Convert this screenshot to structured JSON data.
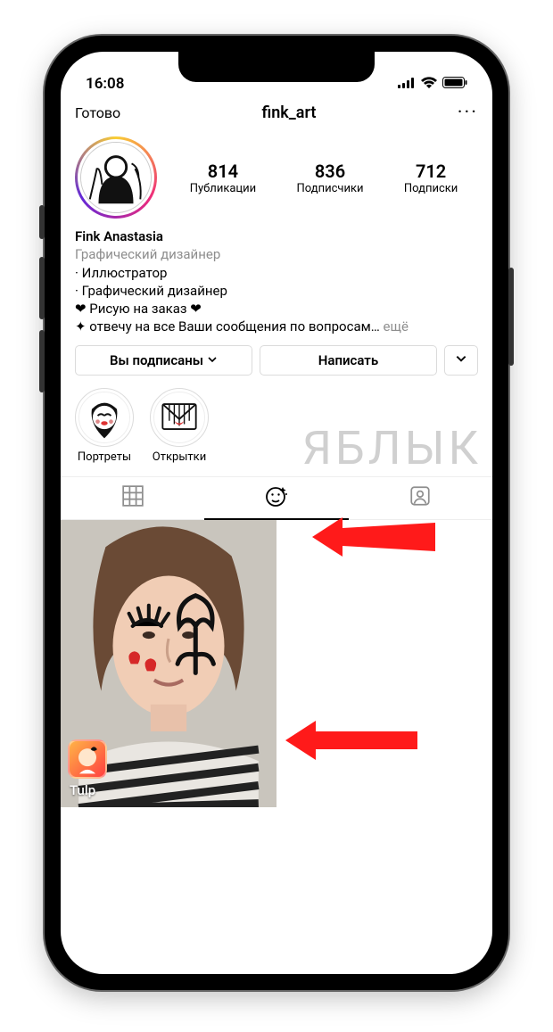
{
  "status": {
    "time": "16:08"
  },
  "nav": {
    "done": "Готово",
    "username": "fink_art",
    "more": "···"
  },
  "stats": {
    "posts": {
      "value": "814",
      "label": "Публикации"
    },
    "followers": {
      "value": "836",
      "label": "Подписчики"
    },
    "following": {
      "value": "712",
      "label": "Подписки"
    }
  },
  "bio": {
    "name": "Fink Anastasia",
    "job": "Графический дизайнер",
    "line1": "· Иллюстратор",
    "line2": "· Графический дизайнер",
    "line3": "❤ Рисую на заказ ❤",
    "line4": "✦ отвечу на все Ваши сообщения по вопросам…",
    "more": "ещё"
  },
  "buttons": {
    "following": "Вы подписаны",
    "message": "Написать"
  },
  "highlights": [
    {
      "label": "Портреты"
    },
    {
      "label": "Открытки"
    }
  ],
  "filters": [
    {
      "label": "Tulp"
    }
  ],
  "watermark": "ЯБЛЫК"
}
